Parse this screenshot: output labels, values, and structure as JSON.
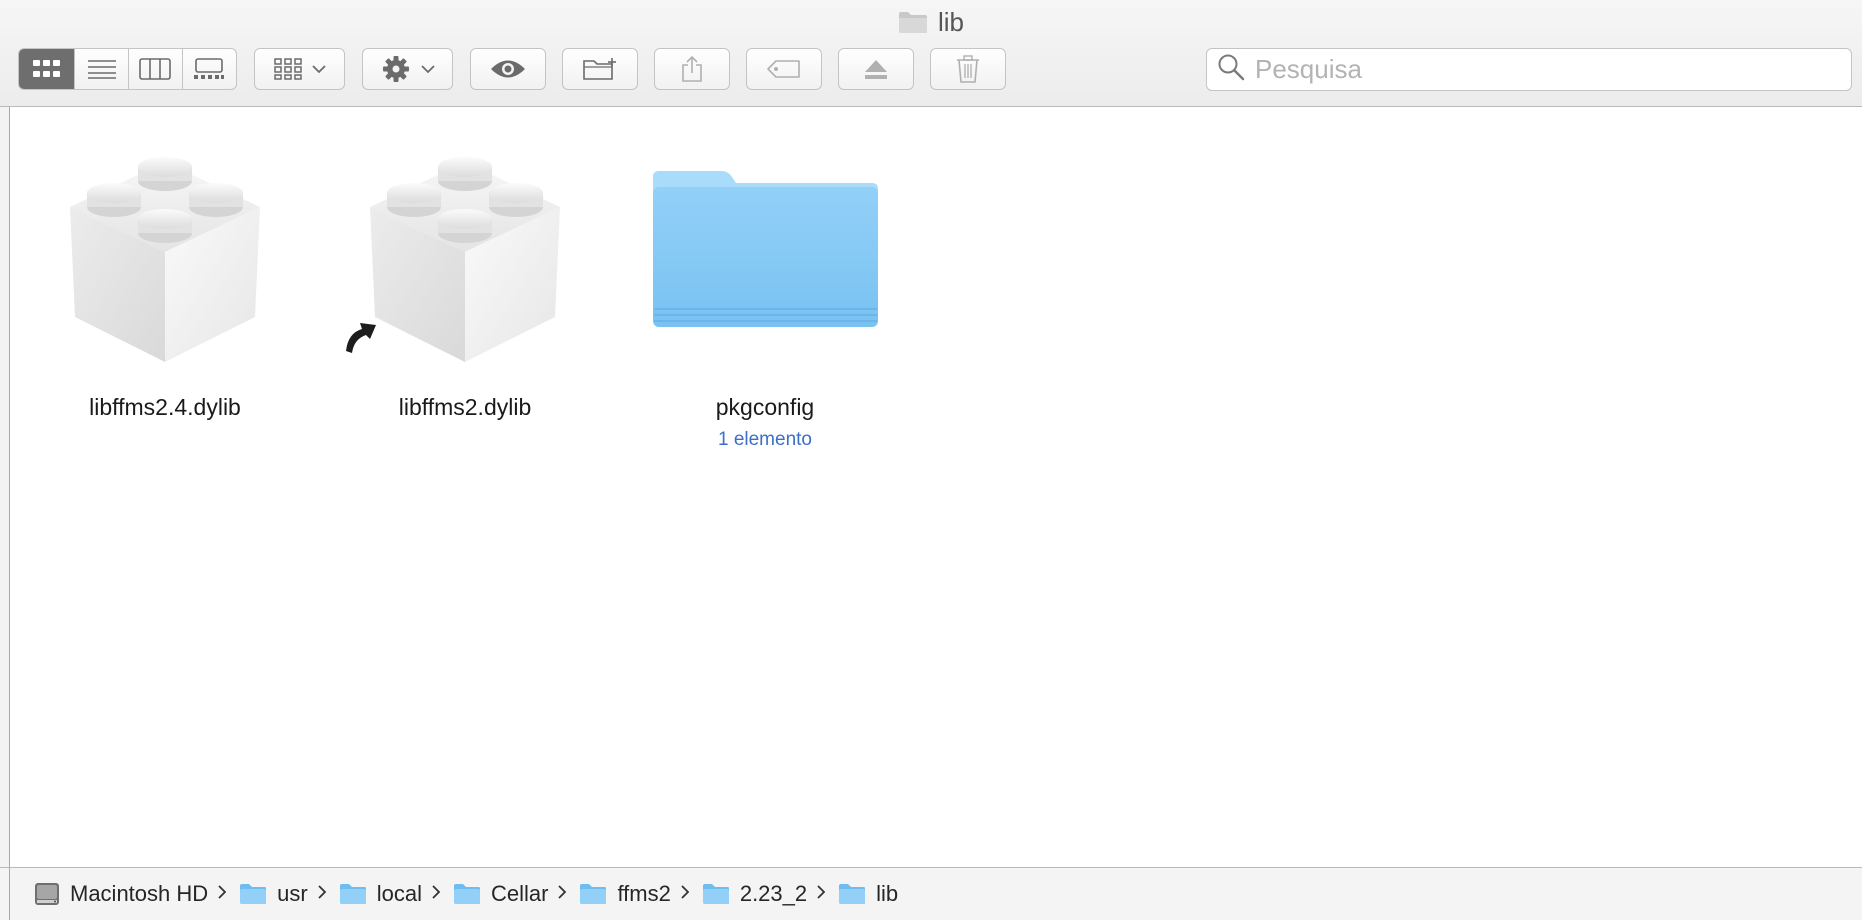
{
  "window": {
    "title": "lib"
  },
  "toolbar": {
    "view_modes": [
      "icons-view",
      "list-view",
      "columns-view",
      "gallery-view"
    ],
    "active_view": "icons-view",
    "buttons": [
      "group-by",
      "action-menu",
      "quick-look",
      "new-folder",
      "share",
      "tags",
      "eject",
      "delete"
    ]
  },
  "search": {
    "placeholder": "Pesquisa",
    "value": ""
  },
  "files": [
    {
      "name": "libffms2.4.dylib",
      "kind": "library",
      "alias": false
    },
    {
      "name": "libffms2.dylib",
      "kind": "library",
      "alias": true
    },
    {
      "name": "pkgconfig",
      "kind": "folder",
      "subtitle": "1 elemento"
    }
  ],
  "pathbar": {
    "items": [
      {
        "label": "Macintosh HD",
        "icon": "hard-drive-icon"
      },
      {
        "label": "usr",
        "icon": "folder-icon"
      },
      {
        "label": "local",
        "icon": "folder-icon"
      },
      {
        "label": "Cellar",
        "icon": "folder-icon"
      },
      {
        "label": "ffms2",
        "icon": "folder-icon"
      },
      {
        "label": "2.23_2",
        "icon": "folder-icon"
      },
      {
        "label": "lib",
        "icon": "folder-icon"
      }
    ]
  },
  "colors": {
    "folder_light": "#9fd3f7",
    "folder_dark": "#6ebcf0",
    "subtitle": "#3d6fc7",
    "active_segment": "#6e6e6e"
  }
}
